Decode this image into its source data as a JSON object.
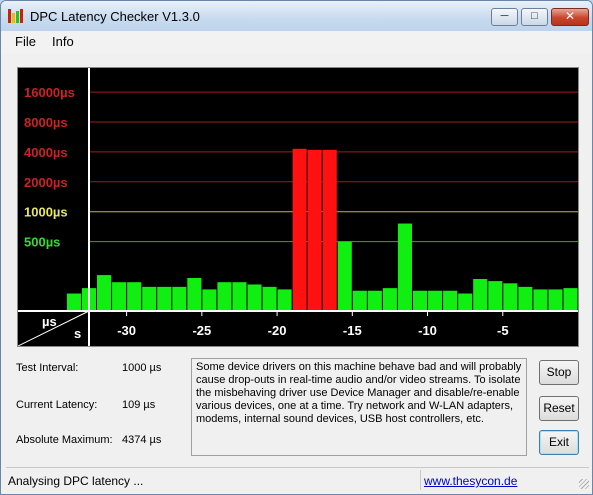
{
  "window": {
    "title": "DPC Latency Checker V1.3.0",
    "icon_colors": [
      "#cc2200",
      "#e8c000",
      "#2bbf2b",
      "#cc2200"
    ],
    "controls": {
      "minimize": "─",
      "maximize": "□",
      "close": "✕"
    }
  },
  "menu": {
    "file": "File",
    "info": "Info"
  },
  "chart_data": {
    "type": "bar",
    "title": "",
    "y_axis_labels": [
      {
        "text": "16000µs",
        "value": 16000,
        "color": "#cc2222"
      },
      {
        "text": "8000µs",
        "value": 8000,
        "color": "#cc2222"
      },
      {
        "text": "4000µs",
        "value": 4000,
        "color": "#cc2222"
      },
      {
        "text": "2000µs",
        "value": 2000,
        "color": "#cc2222"
      },
      {
        "text": "1000µs",
        "value": 1000,
        "color": "#e8e860"
      },
      {
        "text": "500µs",
        "value": 500,
        "color": "#38d838"
      }
    ],
    "y_scale": "log2",
    "y_range_us": [
      100,
      28000
    ],
    "corner_labels": {
      "top": "µs",
      "bottom": "s"
    },
    "x_ticks": [
      -30,
      -25,
      -20,
      -15,
      -10,
      -5
    ],
    "x_range_s": [
      -32.5,
      0
    ],
    "bar_width_s": 1,
    "threshold_us": 2000,
    "bar_colors": {
      "ok": "#11ee11",
      "bad": "#ff1111"
    },
    "values_us": [
      150,
      170,
      230,
      195,
      195,
      175,
      175,
      175,
      215,
      165,
      195,
      195,
      185,
      175,
      165,
      4300,
      4200,
      4200,
      500,
      160,
      160,
      170,
      760,
      160,
      160,
      160,
      150,
      210,
      200,
      190,
      175,
      165,
      165,
      170
    ]
  },
  "info": {
    "test_interval_label": "Test Interval:",
    "test_interval_value": "1000 µs",
    "current_latency_label": "Current Latency:",
    "current_latency_value": "109 µs",
    "absolute_maximum_label": "Absolute Maximum:",
    "absolute_maximum_value": "4374 µs",
    "message": "Some device drivers on this machine behave bad and will probably cause drop-outs in real-time audio and/or video streams. To isolate the misbehaving driver use Device Manager and disable/re-enable various devices, one at a time. Try network and W-LAN adapters, modems, internal sound devices, USB host controllers, etc."
  },
  "buttons": {
    "stop": "Stop",
    "reset": "Reset",
    "exit": "Exit"
  },
  "status": {
    "text": "Analysing DPC latency ...",
    "link": "www.thesycon.de"
  }
}
